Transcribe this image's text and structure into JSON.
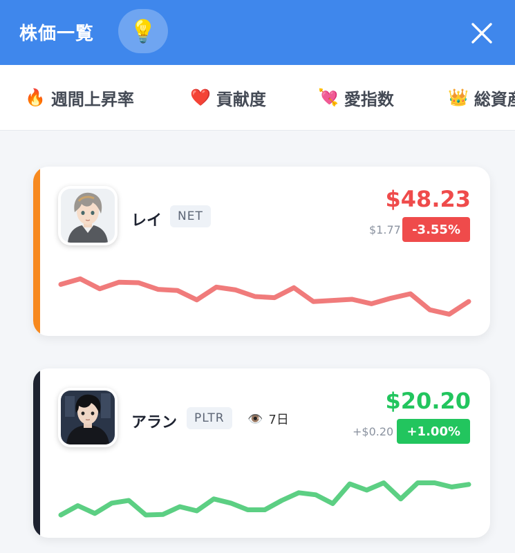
{
  "header": {
    "title": "株価一覧",
    "hint_icon": "💡",
    "close_icon": "close-icon"
  },
  "tabs": [
    {
      "icon": "🔥",
      "label": "週間上昇率"
    },
    {
      "icon": "❤️",
      "label": "貢献度"
    },
    {
      "icon": "💘",
      "label": "愛指数"
    },
    {
      "icon": "👑",
      "label": "総資産"
    }
  ],
  "colors": {
    "header_bg": "#3f87ec",
    "down": "#ef4b4b",
    "down_line": "#f07b7b",
    "up": "#22c55e",
    "up_line": "#5ccf83",
    "card1_accent": "#f7891f",
    "card2_accent": "#1d2230"
  },
  "stocks": [
    {
      "name": "レイ",
      "ticker": "NET",
      "price": "$48.23",
      "change_abs": "$1.77",
      "change_pct": "-3.55%",
      "trend": "down",
      "sparkline": [
        62,
        72,
        54,
        66,
        65,
        53,
        51,
        34,
        57,
        52,
        40,
        38,
        56,
        31,
        33,
        35,
        27,
        37,
        45,
        16,
        8,
        31
      ]
    },
    {
      "name": "アラン",
      "ticker": "PLTR",
      "views_label": "7日",
      "price": "$20.20",
      "change_abs": "+$0.20",
      "change_pct": "+1.00%",
      "trend": "up",
      "sparkline": [
        4,
        22,
        7,
        27,
        32,
        4,
        5,
        20,
        12,
        35,
        27,
        14,
        14,
        32,
        47,
        43,
        26,
        64,
        52,
        66,
        35,
        66,
        66,
        58,
        63
      ]
    }
  ]
}
